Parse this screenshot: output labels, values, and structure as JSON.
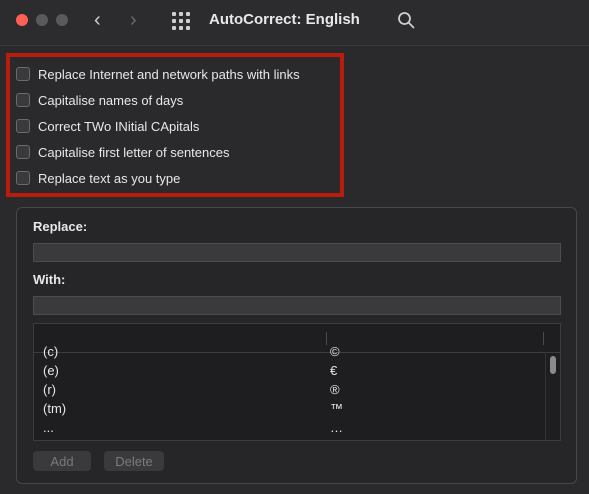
{
  "window": {
    "title": "AutoCorrect: English"
  },
  "toolbar": {
    "back_glyph": "‹",
    "forward_glyph": "›"
  },
  "options": [
    {
      "label": "Replace Internet and network paths with links",
      "checked": false
    },
    {
      "label": "Capitalise names of days",
      "checked": false
    },
    {
      "label": "Correct TWo INitial CApitals",
      "checked": false
    },
    {
      "label": "Capitalise first letter of sentences",
      "checked": false
    },
    {
      "label": "Replace text as you type",
      "checked": false
    }
  ],
  "replace": {
    "label": "Replace:",
    "value": ""
  },
  "with": {
    "label": "With:",
    "value": ""
  },
  "table": {
    "rows": [
      {
        "replace": "(c)",
        "with": "©"
      },
      {
        "replace": "(e)",
        "with": "€"
      },
      {
        "replace": "(r)",
        "with": "®"
      },
      {
        "replace": "(tm)",
        "with": "™"
      },
      {
        "replace": "...",
        "with": "…"
      }
    ]
  },
  "buttons": {
    "add": "Add",
    "delete": "Delete"
  },
  "colors": {
    "highlight": "#b71c0c",
    "close": "#ff5f57"
  },
  "icons": [
    "close-icon",
    "minimize-icon",
    "zoom-icon",
    "chevron-left-icon",
    "chevron-right-icon",
    "grid-icon",
    "search-icon"
  ]
}
